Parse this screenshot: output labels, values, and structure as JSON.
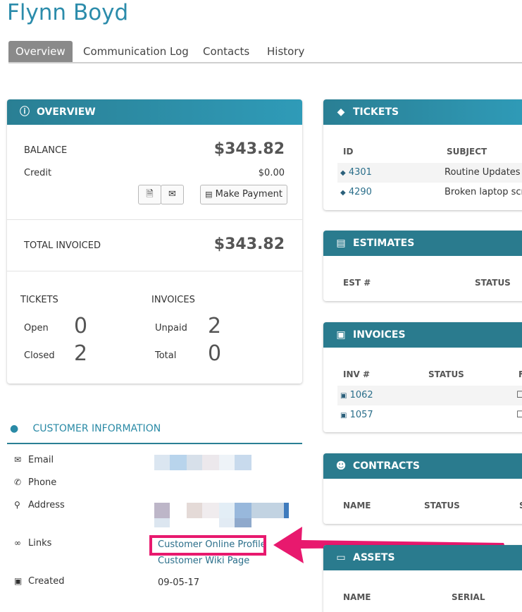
{
  "page": {
    "title": "Flynn Boyd"
  },
  "tabs": [
    {
      "label": "Overview",
      "active": true
    },
    {
      "label": "Communication Log",
      "active": false
    },
    {
      "label": "Contacts",
      "active": false
    },
    {
      "label": "History",
      "active": false
    }
  ],
  "overview": {
    "header": "OVERVIEW",
    "balance_label": "BALANCE",
    "balance_value": "$343.82",
    "credit_label": "Credit",
    "credit_value": "$0.00",
    "make_payment": "Make Payment",
    "total_invoiced_label": "TOTAL INVOICED",
    "total_invoiced_value": "$343.82",
    "tickets_label": "TICKETS",
    "invoices_label": "INVOICES",
    "open_label": "Open",
    "open_value": "0",
    "closed_label": "Closed",
    "closed_value": "2",
    "unpaid_label": "Unpaid",
    "unpaid_value": "2",
    "total_label": "Total",
    "total_value": "0"
  },
  "customer_info": {
    "header": "CUSTOMER INFORMATION",
    "email_label": "Email",
    "phone_label": "Phone",
    "address_label": "Address",
    "links_label": "Links",
    "link1": "Customer Online Profile",
    "link2": "Customer Wiki Page",
    "created_label": "Created",
    "created_value": "09-05-17"
  },
  "tickets": {
    "header": "TICKETS",
    "col_id": "ID",
    "col_subject": "SUBJECT",
    "rows": [
      {
        "id": "4301",
        "subject": "Routine Updates"
      },
      {
        "id": "4290",
        "subject": "Broken laptop scre"
      }
    ]
  },
  "estimates": {
    "header": "ESTIMATES",
    "col_est": "EST #",
    "col_status": "STATUS"
  },
  "invoices": {
    "header": "INVOICES",
    "col_inv": "INV #",
    "col_status": "STATUS",
    "col_extra": "F",
    "rows": [
      {
        "id": "1062"
      },
      {
        "id": "1057"
      }
    ]
  },
  "contracts": {
    "header": "CONTRACTS",
    "col_name": "NAME",
    "col_status": "STATUS",
    "col_extra": "S"
  },
  "assets": {
    "header": "ASSETS",
    "col_name": "NAME",
    "col_serial": "SERIAL"
  },
  "colors": {
    "accent": "#2a7f94",
    "highlight": "#e8196e"
  }
}
